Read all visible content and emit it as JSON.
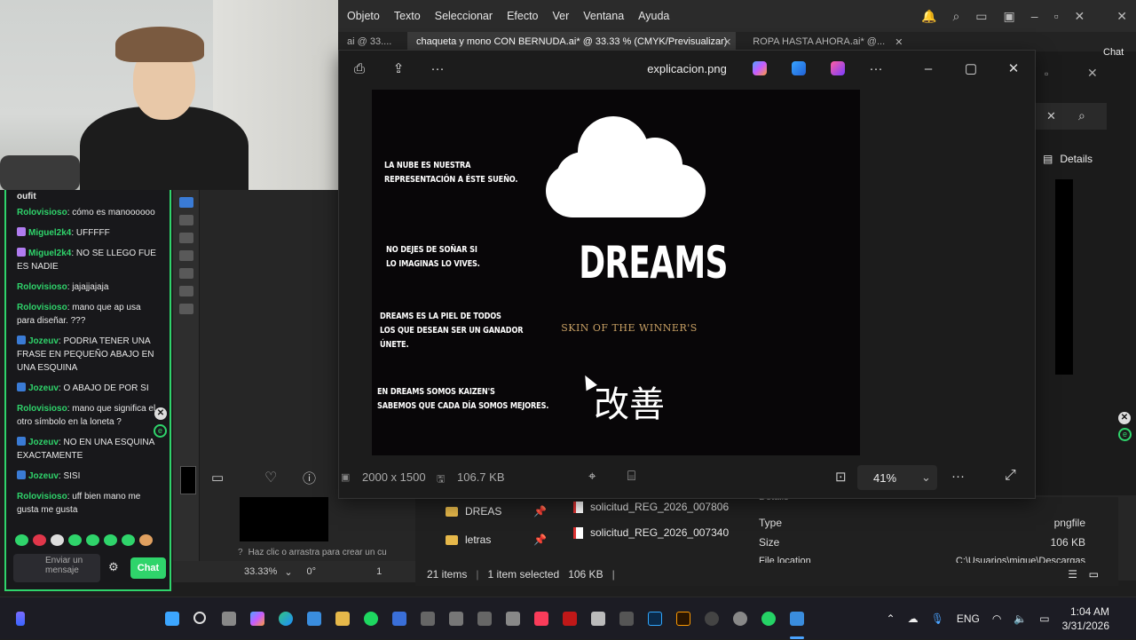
{
  "illustrator": {
    "menu": [
      "Objeto",
      "Texto",
      "Seleccionar",
      "Efecto",
      "Ver",
      "Ventana",
      "Ayuda"
    ],
    "tabs": [
      {
        "label": "ai @ 33....",
        "active": false
      },
      {
        "label": "chaqueta y mono CON BERNUDA.ai* @ 33.33 % (CMYK/Previsualizar)",
        "active": true
      },
      {
        "label": "ROPA HASTA AHORA.ai* @...",
        "active": false
      }
    ],
    "hint": "Haz clic o arrastra para crear un cu",
    "zoom": "33.33%",
    "angle": "0°",
    "page": "1"
  },
  "chat": {
    "top_fragment": "oufit",
    "messages": [
      {
        "user": "Rolovisioso",
        "color": "#2fd46b",
        "badge": "",
        "text": "cómo es manoooooo"
      },
      {
        "user": "Miguel2k4",
        "color": "#2fd46b",
        "badge": "#b07cf0",
        "text": "UFFFFF"
      },
      {
        "user": "Miguel2k4",
        "color": "#2fd46b",
        "badge": "#b07cf0",
        "text": "NO SE LLEGO FUE ES NADIE"
      },
      {
        "user": "Rolovisioso",
        "color": "#2fd46b",
        "badge": "",
        "text": "jajajjajaja"
      },
      {
        "user": "Rolovisioso",
        "color": "#2fd46b",
        "badge": "",
        "text": "mano que ap usa para diseñar. ???"
      },
      {
        "user": "Jozeuv",
        "color": "#2fd46b",
        "badge": "#3a7bd5",
        "text": "PODRIA TENER UNA FRASE EN PEQUEÑO ABAJO EN UNA ESQUINA"
      },
      {
        "user": "Jozeuv",
        "color": "#2fd46b",
        "badge": "#3a7bd5",
        "text": "O ABAJO DE POR SI"
      },
      {
        "user": "Rolovisioso",
        "color": "#2fd46b",
        "badge": "",
        "text": "mano que significa el otro símbolo en la loneta ?"
      },
      {
        "user": "Jozeuv",
        "color": "#2fd46b",
        "badge": "#3a7bd5",
        "text": "NO EN UNA ESQUINA EXACTAMENTE"
      },
      {
        "user": "Jozeuv",
        "color": "#2fd46b",
        "badge": "#3a7bd5",
        "text": "SISI"
      },
      {
        "user": "Rolovisioso",
        "color": "#2fd46b",
        "badge": "",
        "text": "uff bien mano me gusta me gusta"
      }
    ],
    "input_placeholder": "Enviar un mensaje",
    "send_label": "Chat",
    "accent": "#2fd46b"
  },
  "viewer": {
    "title": "explicacion.png",
    "dimensions": "2000 x 1500",
    "filesize": "106.7 KB",
    "zoom": "41%",
    "image": {
      "slogans": [
        "LA NUBE ES NUESTRA\nREPRESENTACIÓN A ÉSTE SUEÑO.",
        "NO DEJES DE SOÑAR SI\nLO IMAGINAS LO VIVES.",
        "DREAMS ES LA PIEL DE TODOS\nLOS QUE DESEAN SER UN GANADOR\nÚNETE.",
        "EN DREAMS SOMOS KAIZEN'S\nSABEMOS QUE CADA DÍA SOMOS MEJORES."
      ],
      "brand": "DREAMS",
      "tagline": "SKIN OF THE WINNER'S",
      "kanji": "改善",
      "tagline_color": "#c8a064"
    }
  },
  "explorer": {
    "folders": [
      "DREAS",
      "letras"
    ],
    "files": [
      "solicitud_REG_2026_007806",
      "solicitud_REG_2026_007340"
    ],
    "details_header": "Details",
    "details": [
      {
        "label": "Type",
        "value": "pngfile"
      },
      {
        "label": "Size",
        "value": "106 KB"
      },
      {
        "label": "File location",
        "value": "C:\\Usuarios\\migue\\Descargas"
      }
    ],
    "status_items": "21 items",
    "status_selected": "1 item selected",
    "status_size": "106 KB",
    "details_button": "Details"
  },
  "taskbar": {
    "language": "ENG",
    "time": "1:04 AM",
    "date": "3/31/2026"
  },
  "right_edge": {
    "chat_fragment": "Chat"
  }
}
